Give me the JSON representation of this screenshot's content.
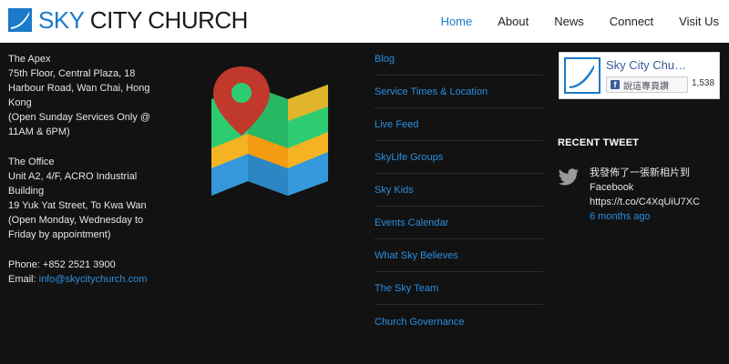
{
  "header": {
    "logo": {
      "sky": "SKY",
      "rest": "CITY CHURCH"
    },
    "nav": [
      "Home",
      "About",
      "News",
      "Connect",
      "Visit Us"
    ],
    "active_nav": "Home"
  },
  "address": {
    "apex": [
      "The Apex",
      "75th Floor, Central Plaza, 18",
      "Harbour Road, Wan Chai, Hong",
      "Kong",
      "(Open Sunday Services Only @",
      "11AM & 6PM)"
    ],
    "office": [
      "The Office",
      "Unit A2, 4/F, ACRO Industrial",
      "Building",
      "19 Yuk Yat Street, To Kwa Wan",
      "(Open Monday, Wednesday to",
      "Friday by appointment)"
    ],
    "phone": "Phone: +852 2521 3900",
    "email_label": "Email: ",
    "email": "info@skycitychurch.com"
  },
  "links": [
    "Blog",
    "Service Times & Location",
    "Live Feed",
    "SkyLife Groups",
    "Sky Kids",
    "Events Calendar",
    "What Sky Believes",
    "The Sky Team",
    "Church Governance"
  ],
  "facebook": {
    "page_name": "Sky City Chu…",
    "like_label": "說這專頁讚",
    "count": "1,538 "
  },
  "tweets": {
    "title": "RECENT TWEET",
    "text_1": "我發佈了一張新相片到",
    "text_2": "Facebook",
    "link": "https://t.co/C4XqUiU7XC",
    "time": "6 months ago"
  },
  "colors": {
    "accent": "#2a8fe0",
    "brand_blue": "#1b7ac9",
    "footer_bg": "#121212"
  }
}
